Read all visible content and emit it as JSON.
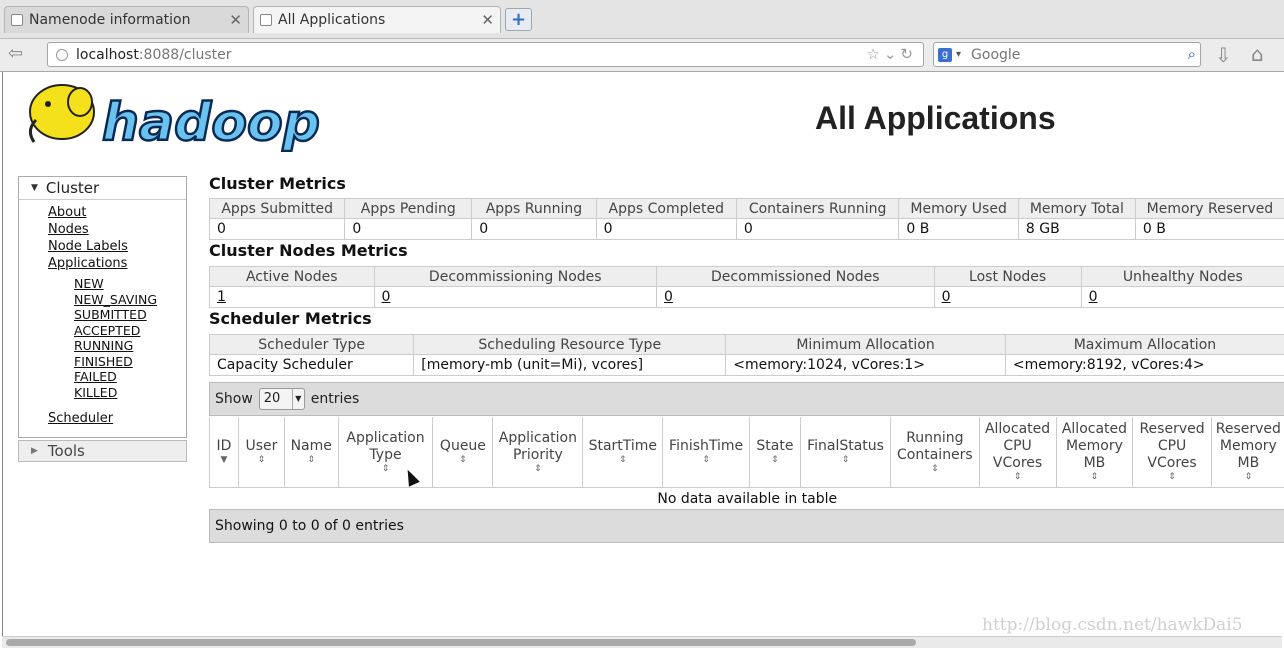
{
  "browser": {
    "tabs": [
      {
        "label": "Namenode information",
        "active": false
      },
      {
        "label": "All Applications",
        "active": true
      }
    ],
    "new_tab": "+",
    "url_host": "localhost",
    "url_rest": ":8088/cluster",
    "search_placeholder": "Google",
    "icons": [
      "back-icon",
      "globe-icon",
      "star-icon",
      "reload-icon",
      "search-engine-icon",
      "magnifier-icon",
      "download-icon",
      "home-icon"
    ]
  },
  "page": {
    "logo_text": "hadoop",
    "title": "All Applications"
  },
  "sidebar": {
    "cluster_label": "Cluster",
    "links": [
      "About",
      "Nodes",
      "Node Labels",
      "Applications"
    ],
    "app_states": [
      "NEW",
      "NEW_SAVING",
      "SUBMITTED",
      "ACCEPTED",
      "RUNNING",
      "FINISHED",
      "FAILED",
      "KILLED"
    ],
    "scheduler": "Scheduler",
    "tools_label": "Tools"
  },
  "cluster_metrics": {
    "title": "Cluster Metrics",
    "headers": [
      "Apps Submitted",
      "Apps Pending",
      "Apps Running",
      "Apps Completed",
      "Containers Running",
      "Memory Used",
      "Memory Total",
      "Memory Reserved"
    ],
    "values": [
      "0",
      "0",
      "0",
      "0",
      "0",
      "0 B",
      "8 GB",
      "0 B"
    ]
  },
  "node_metrics": {
    "title": "Cluster Nodes Metrics",
    "headers": [
      "Active Nodes",
      "Decommissioning Nodes",
      "Decommissioned Nodes",
      "Lost Nodes",
      "Unhealthy Nodes"
    ],
    "values": [
      "1",
      "0",
      "0",
      "0",
      "0"
    ]
  },
  "scheduler_metrics": {
    "title": "Scheduler Metrics",
    "headers": [
      "Scheduler Type",
      "Scheduling Resource Type",
      "Minimum Allocation",
      "Maximum Allocation"
    ],
    "values": [
      "Capacity Scheduler",
      "[memory-mb (unit=Mi), vcores]",
      "<memory:1024, vCores:1>",
      "<memory:8192, vCores:4>"
    ]
  },
  "apps_table": {
    "show_label": "Show",
    "entries_value": "20",
    "entries_label": "entries",
    "columns": [
      "ID",
      "User",
      "Name",
      "Application Type",
      "Queue",
      "Application Priority",
      "StartTime",
      "FinishTime",
      "State",
      "FinalStatus",
      "Running Containers",
      "Allocated CPU VCores",
      "Allocated Memory MB",
      "Reserved CPU VCores",
      "Reserved Memory MB"
    ],
    "empty_message": "No data available in table",
    "footer": "Showing 0 to 0 of 0 entries"
  },
  "watermark": "http://blog.csdn.net/hawkDai5"
}
